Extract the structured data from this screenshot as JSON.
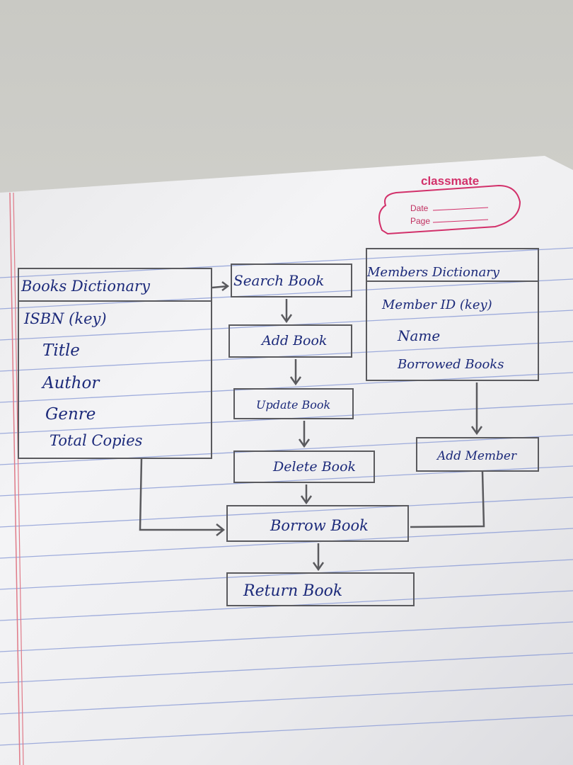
{
  "notebook": {
    "brand": "classmate",
    "date_label": "Date",
    "page_label": "Page"
  },
  "books_dictionary": {
    "title": "Books Dictionary",
    "fields": [
      "ISBN (key)",
      "Title",
      "Author",
      "Genre",
      "Total Copies"
    ]
  },
  "members_dictionary": {
    "title": "Members Dictionary",
    "fields": [
      "Member ID (key)",
      "Name",
      "Borrowed Books"
    ]
  },
  "operations": {
    "search": "Search Book",
    "add": "Add Book",
    "update": "Update Book",
    "delete": "Delete Book",
    "borrow": "Borrow Book",
    "return": "Return Book",
    "add_member": "Add Member"
  },
  "colors": {
    "ink": "#1c2a7a",
    "pencil": "#5a5a5e",
    "rule": "#7b8fd0",
    "margin": "#e07a88",
    "brand": "#d2306a"
  }
}
